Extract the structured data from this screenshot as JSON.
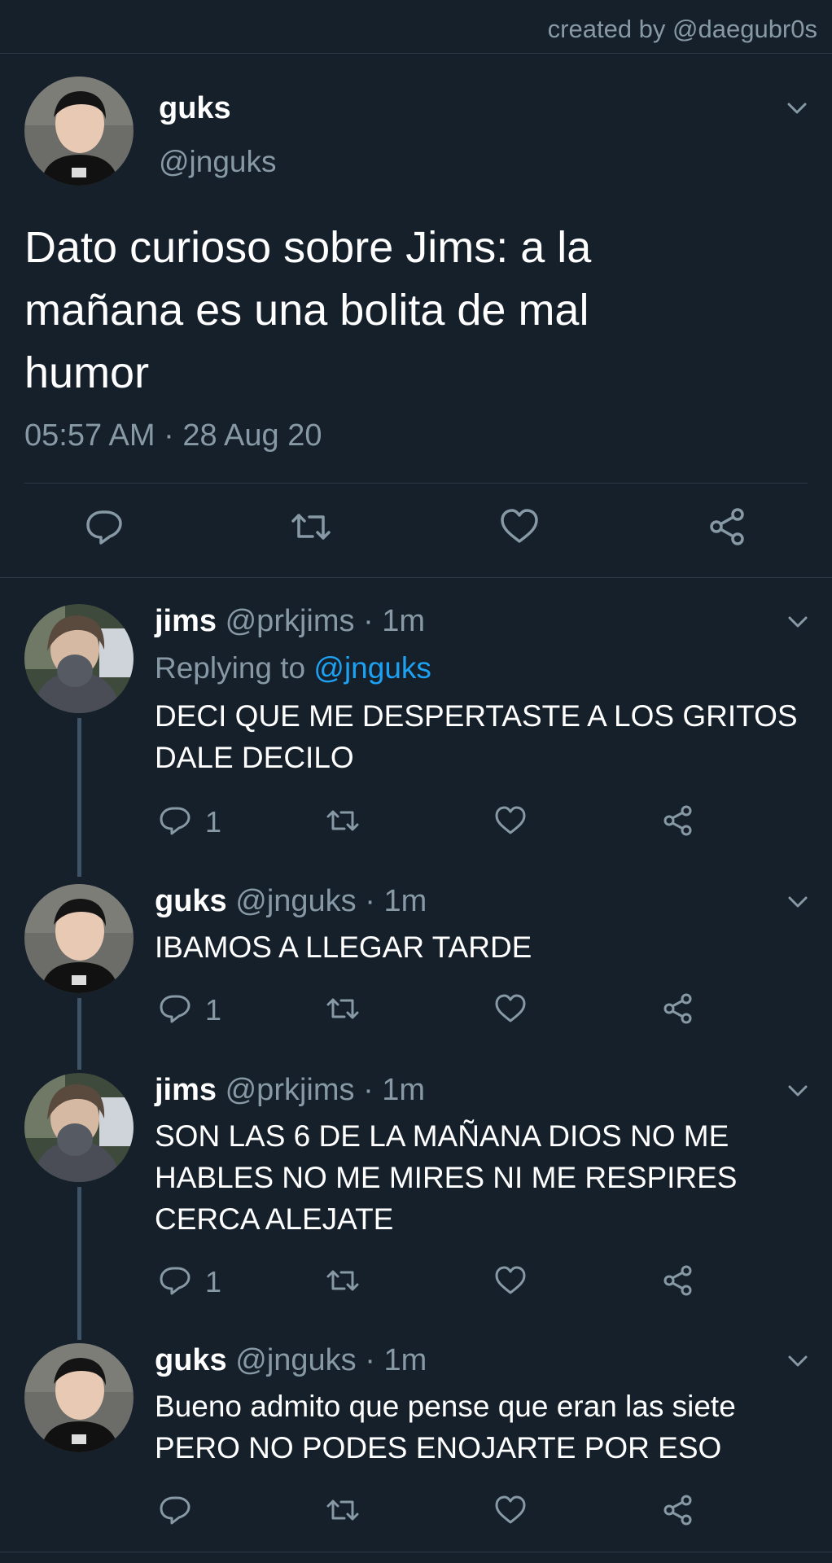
{
  "credit": "created by @daegubr0s",
  "main_tweet": {
    "name": "guks",
    "handle": "@jnguks",
    "text_lines": [
      "Dato curioso sobre Jims: a la",
      "mañana es una bolita de mal",
      "humor"
    ],
    "timestamp": "05:57 AM · 28 Aug 20",
    "actions": [
      "reply-icon",
      "retweet-icon",
      "like-icon",
      "share-icon"
    ]
  },
  "replies": [
    {
      "name": "jims",
      "meta": "@prkjims · 1m",
      "replying_prefix": "Replying to ",
      "replying_handle": "@jnguks",
      "text_lines": [
        "DECI QUE ME DESPERTASTE A LOS GRITOS",
        "DALE DECILO"
      ],
      "reply_count": "1"
    },
    {
      "name": "guks",
      "meta": "@jnguks · 1m",
      "text_lines": [
        "IBAMOS A LLEGAR TARDE"
      ],
      "reply_count": "1"
    },
    {
      "name": "jims",
      "meta": "@prkjims · 1m",
      "text_lines": [
        "SON LAS 6 DE LA MAÑANA DIOS NO ME",
        "HABLES NO ME MIRES NI ME RESPIRES",
        "CERCA ALEJATE"
      ],
      "reply_count": "1"
    },
    {
      "name": "guks",
      "meta": "@jnguks · 1m",
      "text_lines": [
        "Bueno admito que pense que eran las siete",
        "PERO NO PODES ENOJARTE POR ESO"
      ],
      "reply_count": ""
    }
  ],
  "colors": {
    "background": "#15202b",
    "secondary_text": "#8899a6",
    "link": "#1da1f2",
    "divider": "#2b3845",
    "thread_line": "#3d5466"
  }
}
